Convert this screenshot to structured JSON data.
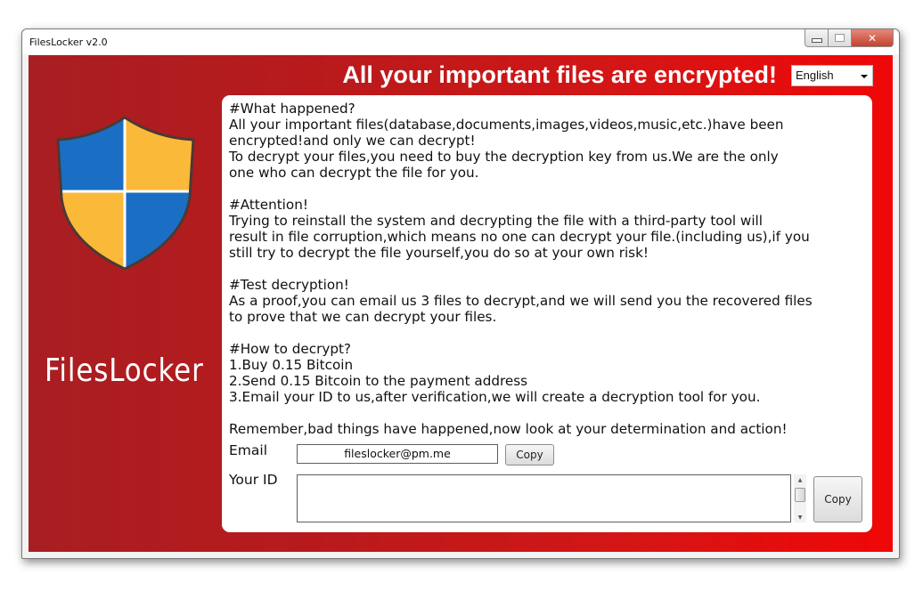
{
  "window": {
    "title": "FilesLocker v2.0",
    "controls": {
      "minimize": "minimize",
      "maximize": "maximize",
      "close": "✕"
    }
  },
  "colors": {
    "background_left": "#a81e22",
    "background_right": "#f00707",
    "shield_blue": "#1a6fc4",
    "shield_yellow": "#fbb93a"
  },
  "header": {
    "banner": "All your important files are encrypted!",
    "language": {
      "selected": "English"
    }
  },
  "sidebar": {
    "logo_icon": "shield-icon",
    "brand": "FilesLocker"
  },
  "note": {
    "text": "#What happened?\nAll your important files(database,documents,images,videos,music,etc.)have been\nencrypted!and only we can decrypt!\nTo decrypt your files,you need to buy the decryption key from us.We are the only\none who can decrypt the file for you.\n\n#Attention!\nTrying to reinstall the system and decrypting the file with a third-party tool will\nresult in file corruption,which means no one can decrypt your file.(including us),if you\nstill try to decrypt the file yourself,you do so at your own risk!\n\n#Test decryption!\nAs a proof,you can email us 3 files to decrypt,and we will send you the recovered files\nto prove that we can decrypt your files.\n\n#How to decrypt?\n1.Buy 0.15 Bitcoin\n2.Send 0.15 Bitcoin to the payment address\n3.Email your ID to us,after verification,we will create a decryption tool for you.\n\nRemember,bad things have happened,now look at your determination and action!"
  },
  "form": {
    "email_label": "Email",
    "email_value": "fileslocker@pm.me",
    "email_copy": "Copy",
    "id_label": "Your ID",
    "id_value": "",
    "id_copy": "Copy"
  }
}
